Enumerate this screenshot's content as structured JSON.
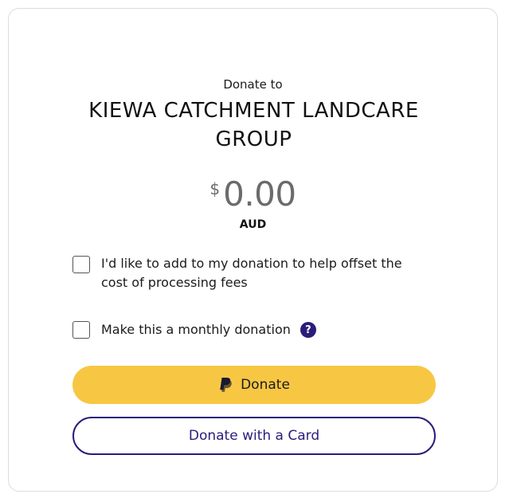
{
  "header": {
    "donate_to_label": "Donate to",
    "organization_name": "KIEWA CATCHMENT LANDCARE GROUP"
  },
  "amount": {
    "currency_symbol": "$",
    "value": "0.00",
    "currency_code": "AUD"
  },
  "options": {
    "cover_fees_label": "I'd like to add to my donation to help offset the cost of processing fees",
    "cover_fees_checked": false,
    "monthly_label": "Make this a monthly donation",
    "monthly_checked": false,
    "help_icon_glyph": "?"
  },
  "buttons": {
    "paypal_label": "Donate",
    "card_label": "Donate with a Card"
  },
  "colors": {
    "paypal_button": "#f7c744",
    "brand_navy": "#2a1d7a",
    "amount_text": "#6b6b6b"
  },
  "icons": {
    "paypal": "paypal-icon",
    "help": "help-icon"
  }
}
